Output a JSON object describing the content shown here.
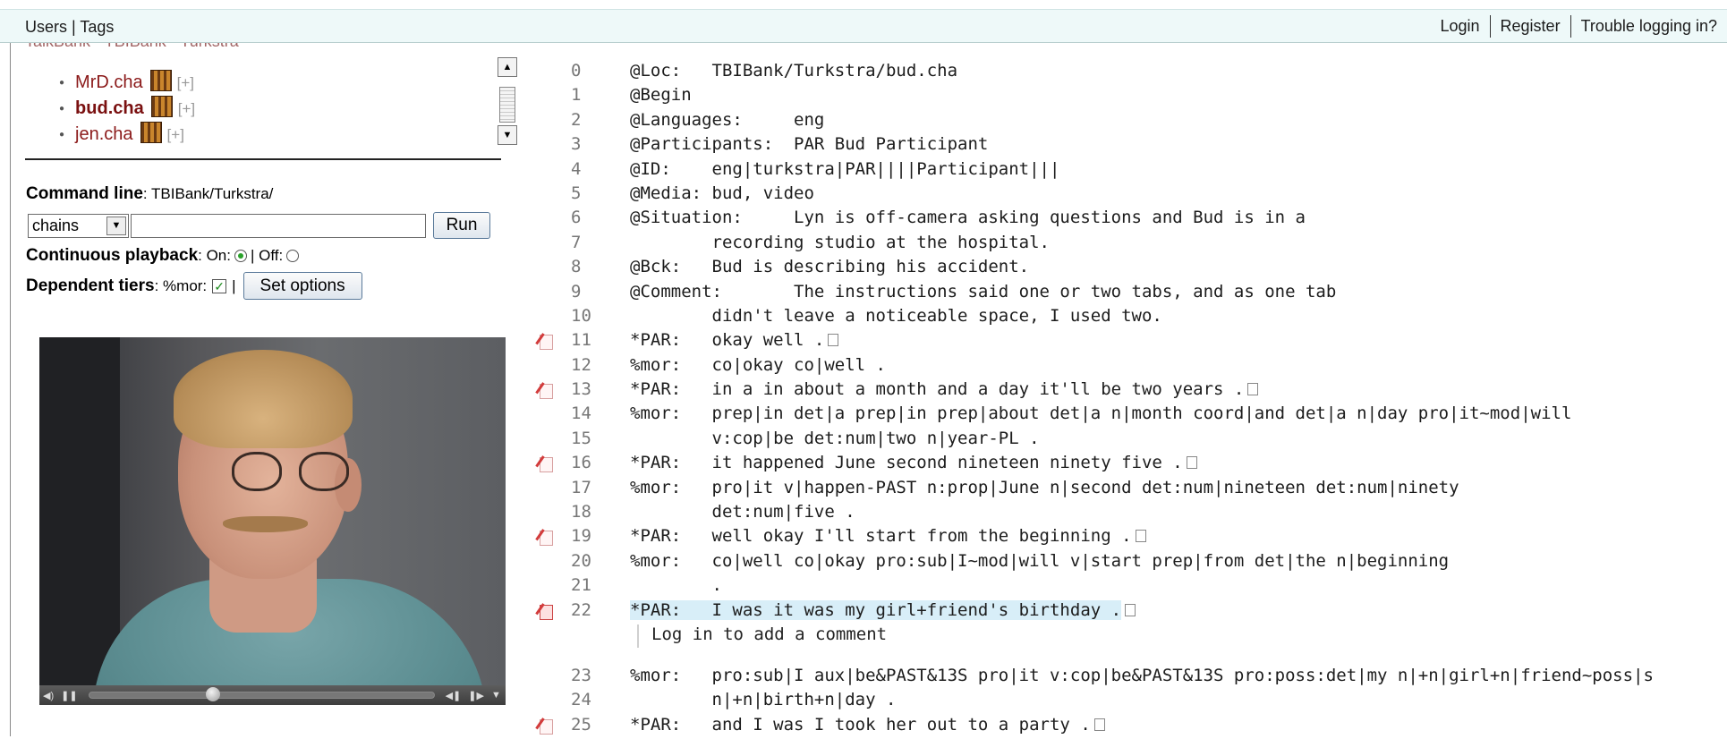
{
  "topbar": {
    "left": "Users | Tags",
    "links": [
      "Login",
      "Register",
      "Trouble logging in?"
    ]
  },
  "tree": {
    "cut_label": "TalkBank · TBIBank · Turkstra",
    "files": [
      {
        "name": "MrD.cha",
        "plus": "[+]",
        "active": false
      },
      {
        "name": "bud.cha",
        "plus": "[+]",
        "active": true
      },
      {
        "name": "jen.cha",
        "plus": "[+]",
        "active": false
      }
    ]
  },
  "command_line": {
    "label": "Command line",
    "path": ": TBIBank/Turkstra/",
    "command": "chains",
    "input_value": "",
    "run_label": "Run"
  },
  "continuous_playback": {
    "label": "Continuous playback",
    "on_label": ": On:",
    "off_label": "| Off:",
    "value": "On"
  },
  "dependent_tiers": {
    "label": "Dependent tiers",
    "mor_label": ": %mor:",
    "mor_checked": true,
    "sep": "|",
    "set_options_label": "Set options"
  },
  "video": {
    "progress_fraction": 0.36
  },
  "transcript": [
    {
      "n": "0",
      "t": "@Loc:   TBIBank/Turkstra/bud.cha"
    },
    {
      "n": "1",
      "t": "@Begin"
    },
    {
      "n": "2",
      "t": "@Languages:     eng"
    },
    {
      "n": "3",
      "t": "@Participants:  PAR Bud Participant"
    },
    {
      "n": "4",
      "t": "@ID:    eng|turkstra|PAR||||Participant|||"
    },
    {
      "n": "5",
      "t": "@Media: bud, video"
    },
    {
      "n": "6",
      "t": "@Situation:     Lyn is off-camera asking questions and Bud is in a"
    },
    {
      "n": "7",
      "t": "        recording studio at the hospital."
    },
    {
      "n": "8",
      "t": "@Bck:   Bud is describing his accident."
    },
    {
      "n": "9",
      "t": "@Comment:       The instructions said one or two tabs, and as one tab"
    },
    {
      "n": "10",
      "t": "        didn't leave a noticeable space, I used two."
    },
    {
      "n": "11",
      "t": "*PAR:   okay well .",
      "edit": true,
      "box": true
    },
    {
      "n": "12",
      "t": "%mor:   co|okay co|well ."
    },
    {
      "n": "13",
      "t": "*PAR:   in a in about a month and a day it'll be two years .",
      "edit": true,
      "box": true
    },
    {
      "n": "14",
      "t": "%mor:   prep|in det|a prep|in prep|about det|a n|month coord|and det|a n|day pro|it~mod|will"
    },
    {
      "n": "15",
      "t": "        v:cop|be det:num|two n|year-PL ."
    },
    {
      "n": "16",
      "t": "*PAR:   it happened June second nineteen ninety five .",
      "edit": true,
      "box": true
    },
    {
      "n": "17",
      "t": "%mor:   pro|it v|happen-PAST n:prop|June n|second det:num|nineteen det:num|ninety"
    },
    {
      "n": "18",
      "t": "        det:num|five ."
    },
    {
      "n": "19",
      "t": "*PAR:   well okay I'll start from the beginning .",
      "edit": true,
      "box": true
    },
    {
      "n": "20",
      "t": "%mor:   co|well co|okay pro:sub|I~mod|will v|start prep|from det|the n|beginning"
    },
    {
      "n": "21",
      "t": "        ."
    },
    {
      "n": "22",
      "t": "*PAR:   I was it was my girl+friend's birthday .",
      "edit": true,
      "box": true,
      "highlight": true,
      "strong": true
    },
    {
      "comment": "Log in to add a comment"
    },
    {
      "n": "23",
      "t": "%mor:   pro:sub|I aux|be&PAST&13S pro|it v:cop|be&PAST&13S pro:poss:det|my n|+n|girl+n|friend~poss|s"
    },
    {
      "n": "24",
      "t": "        n|+n|birth+n|day ."
    },
    {
      "n": "25",
      "t": "*PAR:   and I was I took her out to a party .",
      "edit": true,
      "box": true
    }
  ]
}
